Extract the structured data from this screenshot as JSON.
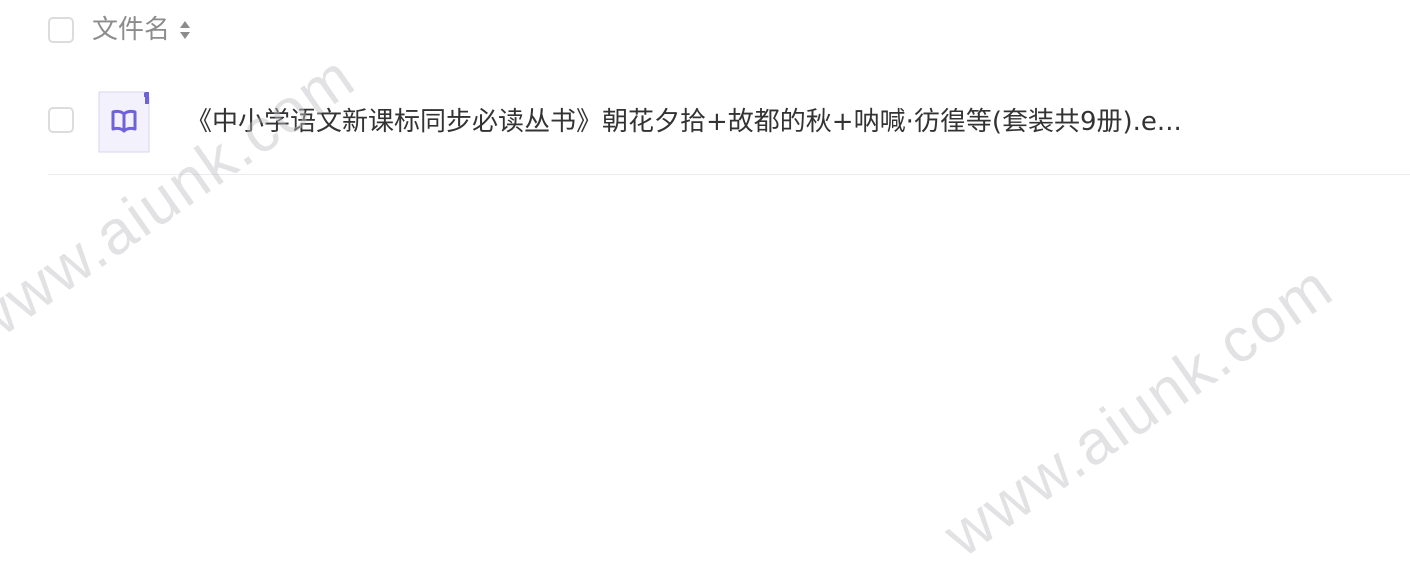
{
  "header": {
    "column_label": "文件名",
    "sort_icon": "sort-icon"
  },
  "files": [
    {
      "name": "《中小学语文新课标同步必读丛书》朝花夕拾+故都的秋+呐喊·彷徨等(套装共9册).e...",
      "icon": "ebook-file-icon",
      "icon_color": "#6f63d9"
    }
  ],
  "watermarks": [
    "www.aiunk.com",
    "www.aiunk.com"
  ],
  "colors": {
    "icon_accent": "#6f63d9",
    "icon_bg": "#f3f1fc",
    "text_primary": "#333333",
    "text_secondary": "#8c8c8c",
    "border": "#dcdcdf"
  }
}
